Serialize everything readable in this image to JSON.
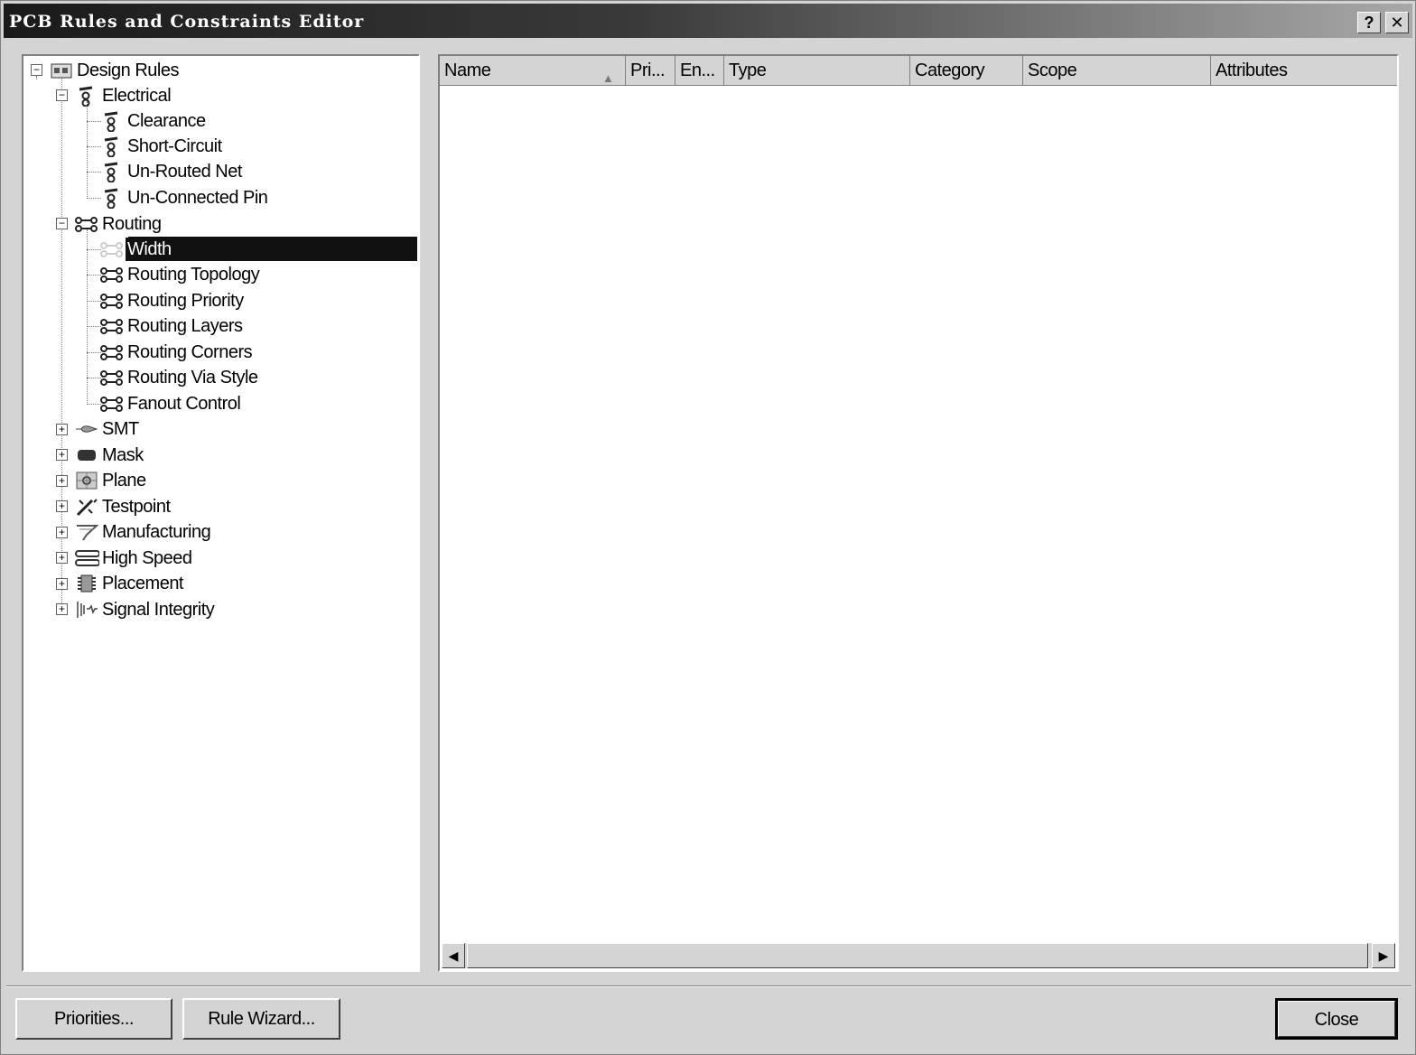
{
  "window": {
    "title": "PCB Rules and Constraints Editor",
    "help_label": "?",
    "close_label": "✕"
  },
  "tree": {
    "root": "Design Rules",
    "electrical": {
      "label": "Electrical",
      "children": [
        "Clearance",
        "Short-Circuit",
        "Un-Routed Net",
        "Un-Connected Pin"
      ]
    },
    "routing": {
      "label": "Routing",
      "children": [
        "Width",
        "Routing Topology",
        "Routing Priority",
        "Routing Layers",
        "Routing Corners",
        "Routing Via Style",
        "Fanout Control"
      ],
      "selected": "Width"
    },
    "collapsed": [
      "SMT",
      "Mask",
      "Plane",
      "Testpoint",
      "Manufacturing",
      "High Speed",
      "Placement",
      "Signal Integrity"
    ],
    "expand_symbol": "+",
    "collapse_symbol": "−"
  },
  "list": {
    "columns": [
      "Name",
      "Pri...",
      "En...",
      "Type",
      "Category",
      "Scope",
      "Attributes"
    ],
    "sort_indicator": "▲",
    "scroll_left": "◀",
    "scroll_right": "▶"
  },
  "buttons": {
    "priorities": "Priorities...",
    "rule_wizard": "Rule Wizard...",
    "close": "Close"
  }
}
